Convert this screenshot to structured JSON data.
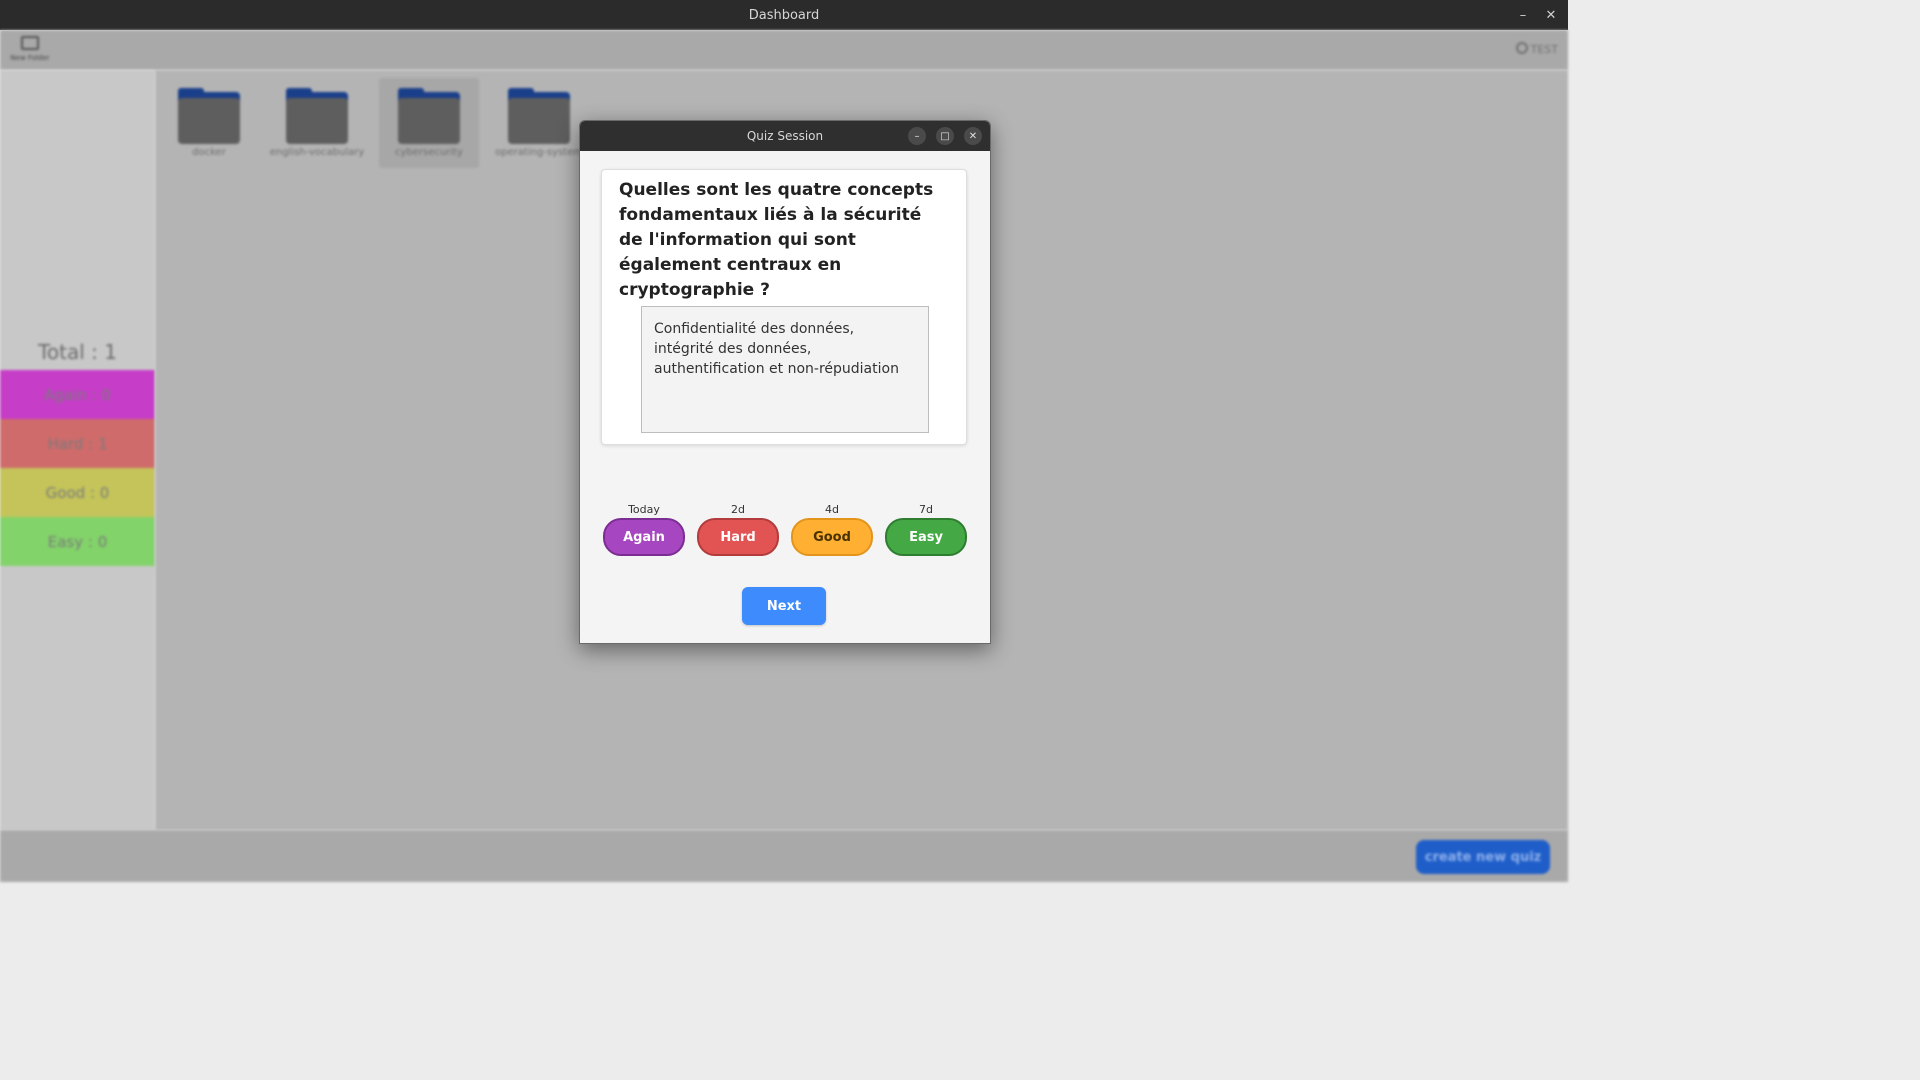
{
  "window": {
    "title": "Dashboard",
    "controls": {
      "minimize": "–",
      "close": "✕"
    }
  },
  "toolbar": {
    "new_folder_label": "New Folder",
    "user_label": "TEST"
  },
  "sidebar": {
    "total": "Total : 1",
    "again": "Again : 0",
    "hard": "Hard : 1",
    "good": "Good : 0",
    "easy": "Easy : 0",
    "colors": {
      "again": "#c63dc8",
      "hard": "#cf6b6b",
      "good": "#c4c45a",
      "easy": "#82d36a"
    }
  },
  "folders": [
    {
      "name": "docker",
      "icon": "folder-icon"
    },
    {
      "name": "english-vocabulary",
      "icon": "folder-icon"
    },
    {
      "name": "cybersecurity",
      "icon": "folder-icon",
      "selected": true
    },
    {
      "name": "operating-system",
      "icon": "folder-icon"
    }
  ],
  "footer": {
    "create_label": "create new quiz"
  },
  "dialog": {
    "title": "Quiz Session",
    "controls": {
      "minimize": "–",
      "maximize": "□",
      "close": "✕"
    },
    "question": "Quelles sont les quatre concepts fondamentaux liés à la sécurité de l'information qui sont également centraux en cryptographie ?",
    "answer": "Confidentialité des données, intégrité des données, authentification et non-répudiation",
    "ratings": [
      {
        "interval": "Today",
        "label": "Again",
        "color": "#a646c0"
      },
      {
        "interval": "2d",
        "label": "Hard",
        "color": "#e25454"
      },
      {
        "interval": "4d",
        "label": "Good",
        "color": "#ffb033"
      },
      {
        "interval": "7d",
        "label": "Easy",
        "color": "#44a845"
      }
    ],
    "next_label": "Next"
  }
}
